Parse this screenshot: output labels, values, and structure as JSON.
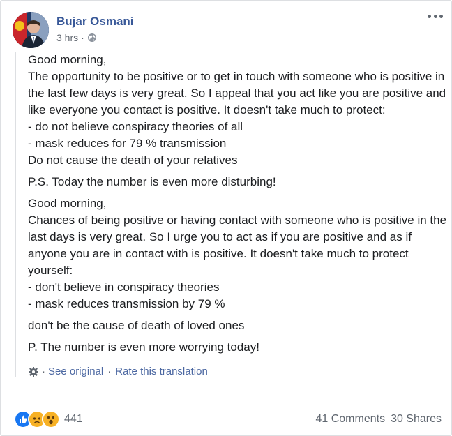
{
  "post": {
    "author": "Bujar Osmani",
    "time": "3 hrs",
    "meta_separator": "·",
    "privacy_icon": "globe-icon",
    "options_icon": "more-horizontal-icon"
  },
  "content": {
    "original_block": [
      "Good morning,\nThe opportunity to be positive or to get in touch with someone who is positive in the last few days is very great. So I appeal that you act like you are positive and like everyone you contact is positive. It doesn't take much to protect:\n- do not believe conspiracy theories of all\n- mask reduces for 79 % transmission\nDo not cause the death of your relatives",
      "P.S. Today the number is even more disturbing!"
    ],
    "translated_block": [
      "Good morning,\nChances of being positive or having contact with someone who is positive in the last days is very great. So I urge you to act as if you are positive and as if anyone you are in contact with is positive. It doesn't take much to protect yourself:\n- don't believe in conspiracy theories\n- mask reduces transmission by 79 %",
      "don't be the cause of death of loved ones",
      "P. The number is even more worrying today!"
    ]
  },
  "translation": {
    "icon": "gear-icon",
    "dot": "·",
    "see_original": "See original",
    "separator": "·",
    "rate": "Rate this translation"
  },
  "footer": {
    "reaction_icons": [
      "like-icon",
      "sad-icon",
      "wow-icon"
    ],
    "reaction_count": "441",
    "comments": "41 Comments",
    "shares": "30 Shares"
  },
  "colors": {
    "author_link": "#385898",
    "like_blue": "#1877f2",
    "reaction_yellow": "#f7b125"
  }
}
